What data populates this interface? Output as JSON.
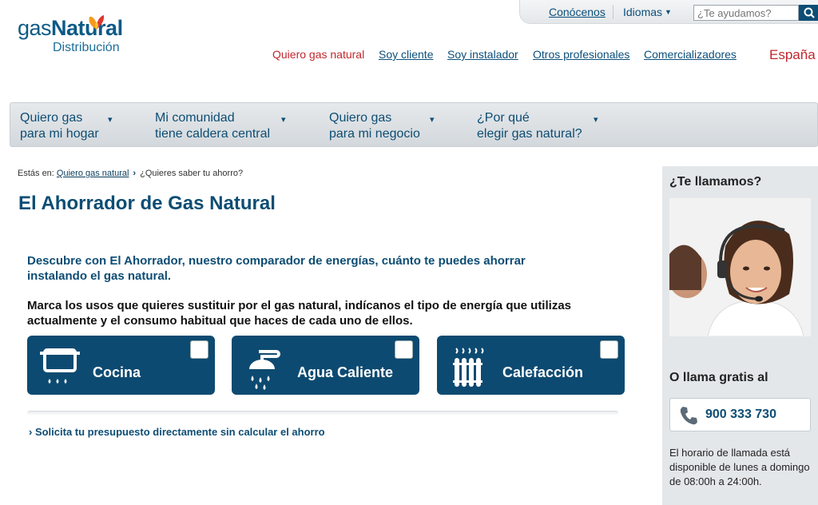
{
  "utility": {
    "conocenos": "Conócenos",
    "idiomas": "Idiomas",
    "search_placeholder": "¿Te ayudamos?"
  },
  "logo": {
    "brand_gas": "gas",
    "brand_natural": "Natural",
    "sub": "Distribución"
  },
  "topnav": [
    {
      "label": "Quiero gas natural",
      "active": true
    },
    {
      "label": "Soy cliente"
    },
    {
      "label": "Soy instalador"
    },
    {
      "label": "Otros profesionales"
    },
    {
      "label": "Comercializadores"
    }
  ],
  "country": "España",
  "menu": [
    {
      "line1": "Quiero gas",
      "line2": "para mi hogar"
    },
    {
      "line1": "Mi comunidad",
      "line2": "tiene caldera central"
    },
    {
      "line1": "Quiero gas",
      "line2": "para mi negocio"
    },
    {
      "line1": "¿Por qué",
      "line2": "elegir gas natural?"
    }
  ],
  "breadcrumb": {
    "prefix": "Estás en:",
    "link": "Quiero gas natural",
    "current": "¿Quieres saber tu ahorro?"
  },
  "page_title": "El Ahorrador de Gas Natural",
  "intro": "Descubre con El Ahorrador, nuestro comparador de energías, cuánto te puedes ahorrar instalando el gas natural.",
  "instructions": "Marca los usos que quieres sustituir por el gas natural, indícanos el tipo de energía que utilizas actualmente y el consumo habitual que haces de cada uno de ellos.",
  "cards": [
    {
      "label": "Cocina",
      "icon": "cooking-pot-icon"
    },
    {
      "label": "Agua Caliente",
      "icon": "shower-icon"
    },
    {
      "label": "Calefacción",
      "icon": "radiator-icon"
    }
  ],
  "solicita": "› Solicita tu presupuesto directamente sin calcular el ahorro",
  "sidebar": {
    "callback_title": "¿Te llamamos?",
    "call_title": "O llama gratis al",
    "phone": "900 333 730",
    "horario": "El horario de llamada está disponible de lunes a domingo de 08:00h a 24:00h."
  },
  "colors": {
    "brand_blue": "#0d4d74",
    "accent_red": "#c0272d",
    "card_bg": "#0d4a71"
  }
}
